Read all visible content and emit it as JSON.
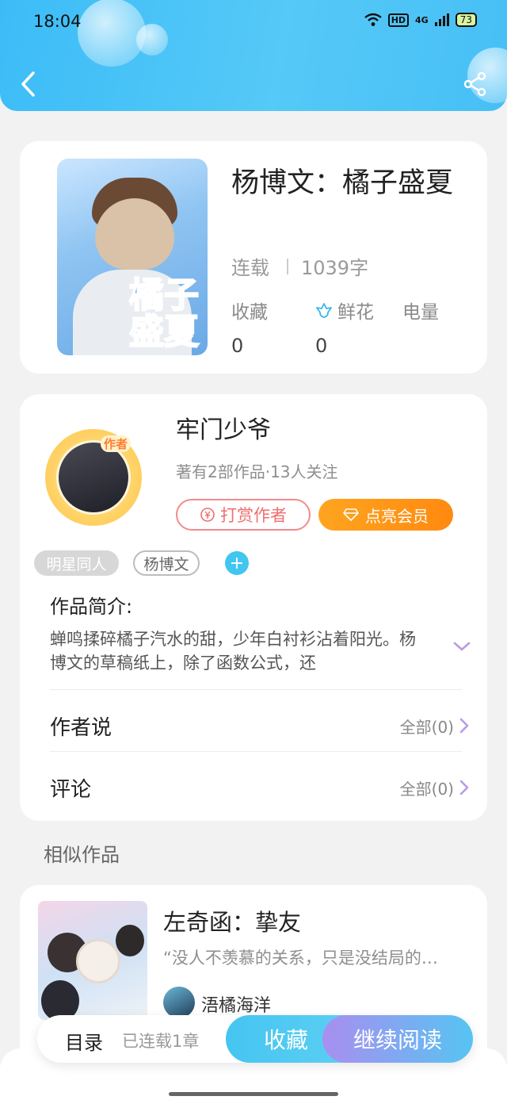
{
  "status_bar": {
    "time": "18:04",
    "network": "4G",
    "hd": "HD",
    "battery": "73"
  },
  "header": {
    "back_icon": "chevron-left-icon",
    "share_icon": "share-icon"
  },
  "book": {
    "title": "杨博文：橘子盛夏",
    "status": "连载",
    "word_count": "1039字",
    "cover_text": "橘子盛夏",
    "stats": [
      {
        "label": "收藏",
        "value": "0"
      },
      {
        "label": "鲜花",
        "value": "0",
        "icon": "flower-icon"
      },
      {
        "label": "电量",
        "value": ""
      }
    ]
  },
  "author": {
    "badge": "作者",
    "name": "牢门少爷",
    "meta": "著有2部作品·13人关注",
    "tip_button": "打赏作者",
    "vip_button": "点亮会员"
  },
  "tags": [
    "明星同人",
    "杨博文"
  ],
  "intro": {
    "title": "作品简介:",
    "text": "蝉鸣揉碎橘子汽水的甜，少年白衬衫沾着阳光。杨博文的草稿纸上，除了函数公式，还"
  },
  "author_says": {
    "label": "作者说",
    "right": "全部(0)"
  },
  "comments": {
    "label": "评论",
    "right": "全部(0)"
  },
  "similar": {
    "section_title": "相似作品",
    "items": [
      {
        "title": "左奇函：挚友",
        "desc": "“没人不羡慕的关系，只是没结局的…",
        "author": "浯橘海洋"
      }
    ]
  },
  "bottom_bar": {
    "toc": "目录",
    "chapters": "已连载1章",
    "favorite": "收藏",
    "continue_reading": "继续阅读"
  },
  "colors": {
    "accent_blue": "#45c5f1",
    "accent_orange": "#ff8a10",
    "tip_red": "#ef6f6f",
    "purple": "#a98ef0"
  }
}
